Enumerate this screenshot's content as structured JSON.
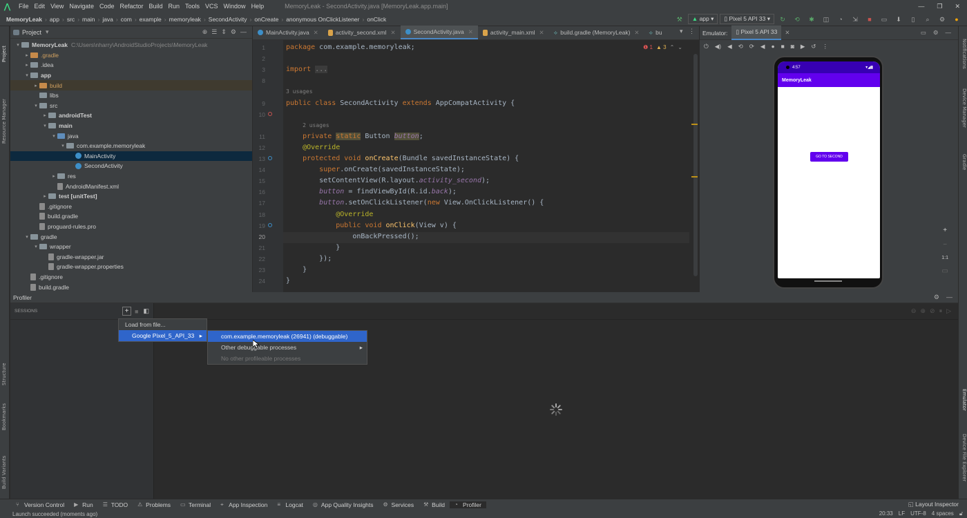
{
  "menu": [
    "File",
    "Edit",
    "View",
    "Navigate",
    "Code",
    "Refactor",
    "Build",
    "Run",
    "Tools",
    "VCS",
    "Window",
    "Help"
  ],
  "window_title": "MemoryLeak - SecondActivity.java [MemoryLeak.app.main]",
  "breadcrumb": [
    "MemoryLeak",
    "app",
    "src",
    "main",
    "java",
    "com",
    "example",
    "memoryleak",
    "SecondActivity",
    "onCreate",
    "anonymous OnClickListener",
    "onClick"
  ],
  "run_config": "app",
  "device": "Pixel 5 API 33",
  "project_panel": {
    "title": "Project",
    "tree": [
      {
        "label": "MemoryLeak",
        "extra": "C:\\Users\\nharry\\AndroidStudioProjects\\MemoryLeak",
        "indent": 0,
        "arrow": "▾",
        "kind": "folder",
        "bold": true
      },
      {
        "label": ".gradle",
        "indent": 1,
        "arrow": "▸",
        "kind": "folder-orange"
      },
      {
        "label": ".idea",
        "indent": 1,
        "arrow": "▸",
        "kind": "folder"
      },
      {
        "label": "app",
        "indent": 1,
        "arrow": "▾",
        "kind": "folder",
        "bold": true
      },
      {
        "label": "build",
        "indent": 2,
        "arrow": "▸",
        "kind": "folder-orange"
      },
      {
        "label": "libs",
        "indent": 2,
        "arrow": "",
        "kind": "folder"
      },
      {
        "label": "src",
        "indent": 2,
        "arrow": "▾",
        "kind": "folder"
      },
      {
        "label": "androidTest",
        "indent": 3,
        "arrow": "▸",
        "kind": "folder",
        "bold": true
      },
      {
        "label": "main",
        "indent": 3,
        "arrow": "▾",
        "kind": "folder",
        "bold": true
      },
      {
        "label": "java",
        "indent": 4,
        "arrow": "▾",
        "kind": "folder-blue"
      },
      {
        "label": "com.example.memoryleak",
        "indent": 5,
        "arrow": "▾",
        "kind": "folder"
      },
      {
        "label": "MainActivity",
        "indent": 6,
        "arrow": "",
        "kind": "class",
        "selected": true
      },
      {
        "label": "SecondActivity",
        "indent": 6,
        "arrow": "",
        "kind": "class"
      },
      {
        "label": "res",
        "indent": 4,
        "arrow": "▸",
        "kind": "folder"
      },
      {
        "label": "AndroidManifest.xml",
        "indent": 4,
        "arrow": "",
        "kind": "file"
      },
      {
        "label": "test [unitTest]",
        "indent": 3,
        "arrow": "▸",
        "kind": "folder",
        "bold": true
      },
      {
        "label": ".gitignore",
        "indent": 2,
        "arrow": "",
        "kind": "file"
      },
      {
        "label": "build.gradle",
        "indent": 2,
        "arrow": "",
        "kind": "file"
      },
      {
        "label": "proguard-rules.pro",
        "indent": 2,
        "arrow": "",
        "kind": "file"
      },
      {
        "label": "gradle",
        "indent": 1,
        "arrow": "▾",
        "kind": "folder"
      },
      {
        "label": "wrapper",
        "indent": 2,
        "arrow": "▾",
        "kind": "folder"
      },
      {
        "label": "gradle-wrapper.jar",
        "indent": 3,
        "arrow": "",
        "kind": "file"
      },
      {
        "label": "gradle-wrapper.properties",
        "indent": 3,
        "arrow": "",
        "kind": "file"
      },
      {
        "label": ".gitignore",
        "indent": 1,
        "arrow": "",
        "kind": "file"
      },
      {
        "label": "build.gradle",
        "indent": 1,
        "arrow": "",
        "kind": "file"
      }
    ]
  },
  "editor_tabs": [
    {
      "label": "MainActivity.java",
      "active": false
    },
    {
      "label": "activity_second.xml",
      "active": false
    },
    {
      "label": "SecondActivity.java",
      "active": true
    },
    {
      "label": "activity_main.xml",
      "active": false
    },
    {
      "label": "build.gradle (MemoryLeak)",
      "active": false
    },
    {
      "label": "bu",
      "active": false
    }
  ],
  "inspections": {
    "errors": "1",
    "warnings": "3"
  },
  "code_lines": [
    {
      "n": "1",
      "html": "<span class='kw'>package</span> com.example.memoryleak;"
    },
    {
      "n": "2",
      "html": ""
    },
    {
      "n": "3",
      "html": "<span class='kw'>import</span> <span style='background:#3b3b3b;color:#888'>...</span>"
    },
    {
      "n": "8",
      "html": ""
    },
    {
      "n": "",
      "html": "<span class='hint'>3 usages</span>"
    },
    {
      "n": "9",
      "html": "<span class='kw'>public class</span> SecondActivity <span class='kw'>extends</span> AppCompatActivity {"
    },
    {
      "n": "10",
      "html": ""
    },
    {
      "n": "",
      "html": "    <span class='hint'>2 usages</span>"
    },
    {
      "n": "11",
      "html": "    <span class='kw'>private</span> <span class='kw' style='background:#52503a'>static</span> Button <span class='it' style='background:#52503a'>button</span>;"
    },
    {
      "n": "12",
      "html": "    <span class='ann'>@Override</span>"
    },
    {
      "n": "13",
      "html": "    <span class='kw'>protected void</span> <span class='fn'>onCreate</span>(Bundle savedInstanceState) {"
    },
    {
      "n": "14",
      "html": "        <span class='kw'>super</span>.onCreate(savedInstanceState);"
    },
    {
      "n": "15",
      "html": "        setContentView(R.layout.<span class='it'>activity_second</span>);"
    },
    {
      "n": "16",
      "html": "        <span class='it'>button</span> = findViewById(R.id.<span class='it'>back</span>);"
    },
    {
      "n": "17",
      "html": "        <span class='it'>button</span>.setOnClickListener(<span class='kw'>new</span> View.OnClickListener() {"
    },
    {
      "n": "18",
      "html": "            <span class='ann'>@Override</span>"
    },
    {
      "n": "19",
      "html": "            <span class='kw'>public void</span> <span class='fn'>onClick</span>(View v) {"
    },
    {
      "n": "20",
      "html": "                onBackPressed();"
    },
    {
      "n": "21",
      "html": "            }"
    },
    {
      "n": "22",
      "html": "        });"
    },
    {
      "n": "23",
      "html": "    }"
    },
    {
      "n": "24",
      "html": "}"
    }
  ],
  "emulator": {
    "tab_label": "Emulator:",
    "device_tab": "Pixel 5 API 33",
    "status_time": "4:57",
    "app_title": "MemoryLeak",
    "button_label": "GO TO SECOND",
    "zoom_label": "1:1"
  },
  "profiler": {
    "title": "Profiler",
    "sessions_label": "SESSIONS",
    "menu1": [
      "Load from file...",
      "Google Pixel_5_API_33"
    ],
    "menu2": [
      "com.example.memoryleak (26941) (debuggable)",
      "Other debuggable processes",
      "No other profileable processes"
    ]
  },
  "bottom_tools": [
    "Version Control",
    "Run",
    "TODO",
    "Problems",
    "Terminal",
    "App Inspection",
    "Logcat",
    "App Quality Insights",
    "Services",
    "Build",
    "Profiler"
  ],
  "layout_inspector": "Layout Inspector",
  "status": {
    "message": "Launch succeeded (moments ago)",
    "position": "20:33",
    "line_sep": "LF",
    "encoding": "UTF-8",
    "indent": "4 spaces"
  },
  "left_strip": [
    "Project",
    "Resource Manager",
    "Structure",
    "Bookmarks",
    "Build Variants"
  ],
  "right_strip": [
    "Notifications",
    "Device Manager",
    "Gradle",
    "Emulator",
    "Device File Explorer"
  ],
  "colors": {
    "accent": "#4a88c7",
    "phone_bar": "#6200ee",
    "selection": "#2f65ca"
  }
}
